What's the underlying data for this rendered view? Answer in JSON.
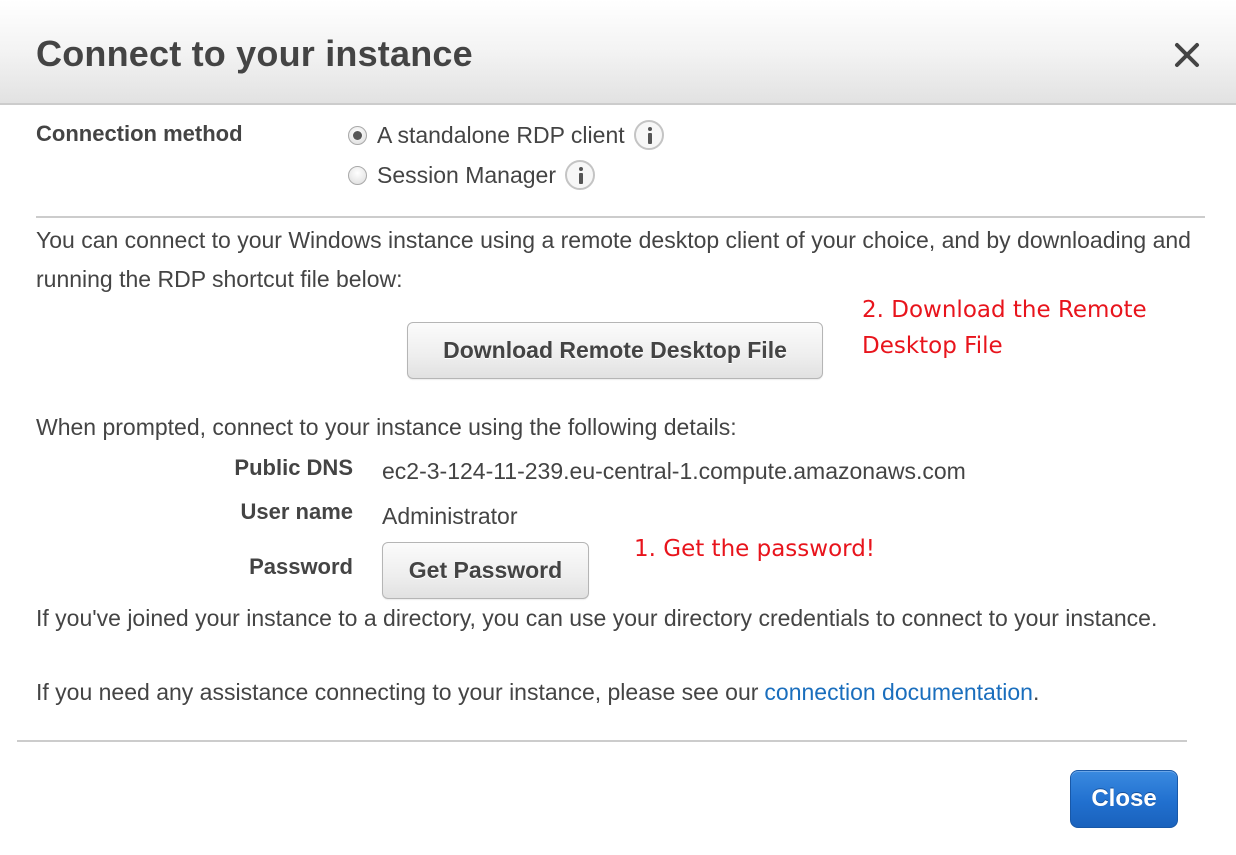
{
  "dialog": {
    "title": "Connect to your instance",
    "close_icon": "close-x-icon"
  },
  "connection_method": {
    "label": "Connection method",
    "options": [
      {
        "label": "A standalone RDP client",
        "selected": true,
        "info_icon": "info-icon"
      },
      {
        "label": "Session Manager",
        "selected": false,
        "info_icon": "info-icon"
      }
    ]
  },
  "intro_text": "You can connect to your Windows instance using a remote desktop client of your choice, and by downloading and running the RDP shortcut file below:",
  "download_button": {
    "label": "Download Remote Desktop File"
  },
  "annotations": {
    "step2": "2. Download the Remote Desktop File",
    "step1": "1. Get the password!",
    "color": "#e8141c"
  },
  "prompted_text": "When prompted, connect to your instance using the following details:",
  "details": {
    "public_dns": {
      "label": "Public DNS",
      "value": "ec2-3-124-11-239.eu-central-1.compute.amazonaws.com"
    },
    "user_name": {
      "label": "User name",
      "value": "Administrator"
    },
    "password": {
      "label": "Password",
      "button_label": "Get Password"
    }
  },
  "directory_text": "If you've joined your instance to a directory, you can use your directory credentials to connect to your instance.",
  "assistance": {
    "text": "If you need any assistance connecting to your instance, please see our",
    "link_label": "connection documentation",
    "suffix": "."
  },
  "footer": {
    "close_button": "Close"
  },
  "colors": {
    "primary_button": "#2170cf",
    "link": "#1a6ebd",
    "text": "#444444",
    "divider": "#cccccc"
  }
}
